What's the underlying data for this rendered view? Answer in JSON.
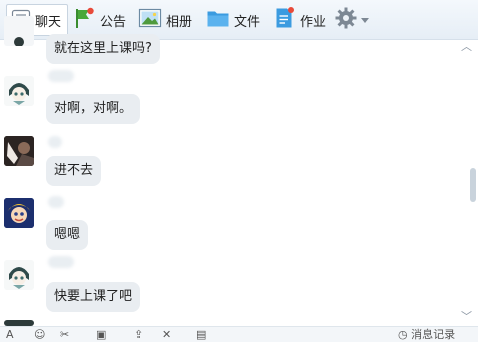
{
  "toolbar": {
    "tabs": [
      {
        "label": "聊天",
        "icon": "chat-icon"
      },
      {
        "label": "公告",
        "icon": "announcement-flag-icon"
      },
      {
        "label": "相册",
        "icon": "photo-album-icon"
      },
      {
        "label": "文件",
        "icon": "folder-icon"
      },
      {
        "label": "作业",
        "icon": "homework-icon"
      }
    ],
    "settings_icon": "gear-icon",
    "dropdown_icon": "chevron-down-icon"
  },
  "messages": [
    {
      "text": "就在这里上课吗?",
      "avatar": "cartoon-girl-avatar"
    },
    {
      "text": "对啊，对啊。",
      "avatar": "cartoon-girl-avatar"
    },
    {
      "text": "进不去",
      "avatar": "photo-avatar"
    },
    {
      "text": "嗯嗯",
      "avatar": "cartoon-boy-avatar"
    },
    {
      "text": "快要上课了吧",
      "avatar": "cartoon-girl-avatar"
    }
  ],
  "bottom": {
    "history_label": "消息记录"
  },
  "colors": {
    "bubble": "#e9edf1",
    "toolbar": "#eaf1f8",
    "accent_red": "#e84a3a"
  }
}
